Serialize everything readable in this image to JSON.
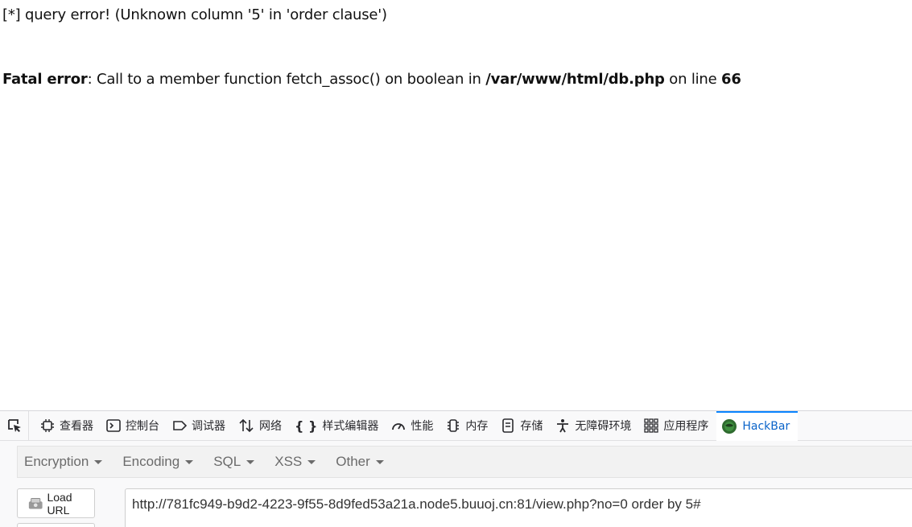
{
  "page": {
    "query_error": "[*] query error! (Unknown column '5' in 'order clause')",
    "fatal": {
      "label": "Fatal error",
      "message": ": Call to a member function fetch_assoc() on boolean in ",
      "path": "/var/www/html/db.php",
      "on_line": " on line ",
      "line": "66"
    }
  },
  "devtools": {
    "tabs": [
      {
        "label": "查看器",
        "icon": "inspector-icon"
      },
      {
        "label": "控制台",
        "icon": "console-icon"
      },
      {
        "label": "调试器",
        "icon": "debugger-icon"
      },
      {
        "label": "网络",
        "icon": "network-icon"
      },
      {
        "label": "样式编辑器",
        "icon": "style-editor-icon"
      },
      {
        "label": "性能",
        "icon": "performance-icon"
      },
      {
        "label": "内存",
        "icon": "memory-icon"
      },
      {
        "label": "存储",
        "icon": "storage-icon"
      },
      {
        "label": "无障碍环境",
        "icon": "accessibility-icon"
      },
      {
        "label": "应用程序",
        "icon": "application-icon"
      },
      {
        "label": "HackBar",
        "icon": "hackbar-icon",
        "active": true
      }
    ]
  },
  "hackbar": {
    "menu": [
      "Encryption",
      "Encoding",
      "SQL",
      "XSS",
      "Other"
    ],
    "load_url_label": "Load URL",
    "url": "http://781fc949-b9d2-4223-9f55-8d9fed53a21a.node5.buuoj.cn:81/view.php?no=0 order by 5#"
  },
  "colors": {
    "active_tab": "#0a63c9",
    "menu_text": "#6b6b6b"
  }
}
